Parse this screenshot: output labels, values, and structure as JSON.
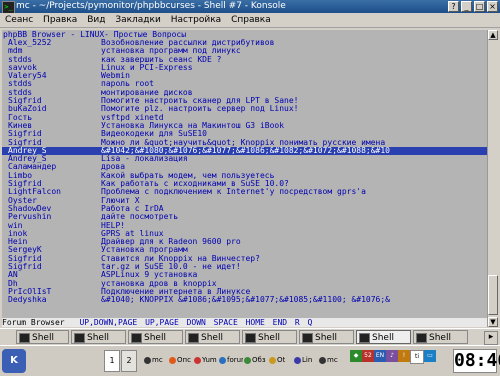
{
  "window": {
    "title": "mc - ~/Projects/pymonitor/phpbbcurses - Shell #7 - Konsole",
    "app_icon": "terminal-icon"
  },
  "menu": [
    "Сеанс",
    "Правка",
    "Вид",
    "Закладки",
    "Настройка",
    "Справка"
  ],
  "terminal": {
    "title_line": "phpBB Browser - LINUX- Простые Вопросы",
    "rows": [
      {
        "author": "Alex_5252",
        "subject": "Возобновление рассылки дистрибутивов"
      },
      {
        "author": "mdm",
        "subject": "установка программ под линукс"
      },
      {
        "author": "stdds",
        "subject": "как завершить сеанс KDE ?"
      },
      {
        "author": "savvok",
        "subject": "Linux и PCI-Express"
      },
      {
        "author": "Valery54",
        "subject": "Webmin"
      },
      {
        "author": "stdds",
        "subject": "пароль root"
      },
      {
        "author": "stdds",
        "subject": "монтирование дисков"
      },
      {
        "author": "Sigfrid",
        "subject": "Помогите настроить сканер для LPT в Sane!"
      },
      {
        "author": "buKaZoid",
        "subject": "Помогите plz. настроить сервер под Linux!"
      },
      {
        "author": "Гость",
        "subject": "vsftpd  xinetd"
      },
      {
        "author": "Кинев",
        "subject": "Установка Линукса на Макинтош G3 iBook"
      },
      {
        "author": "Sigfrid",
        "subject": "Видеокодеки для SuSE10"
      },
      {
        "author": "Sigfrid",
        "subject": "Можно ли &quot;научить&quot; Knoppix понимать русские имена"
      },
      {
        "author": "Andrey_S",
        "subject": "&#1042;&#1080;&#1076;&#1077;&#1086;&#1082;&#1072;&#1088;&#10",
        "selected": true
      },
      {
        "author": "Andrey_S",
        "subject": "Lisa - локализация"
      },
      {
        "author": "Саламандер",
        "subject": "дрова"
      },
      {
        "author": "Limbo",
        "subject": "Какой выбрать модем, чем пользуетесь"
      },
      {
        "author": "Sigfrid",
        "subject": "Как работать с исходниками в SuSE 10.0?"
      },
      {
        "author": "LightFalcon",
        "subject": "Проблема с подключением к Internet'у посредством gprs'а"
      },
      {
        "author": "Oyster",
        "subject": "Глючит X"
      },
      {
        "author": "ShadowDev",
        "subject": "Работа с IrDA"
      },
      {
        "author": "Pervushin",
        "subject": "дайте посмотреть"
      },
      {
        "author": "win",
        "subject": "HELP!"
      },
      {
        "author": "inok",
        "subject": "GPRS at linux"
      },
      {
        "author": "Hein",
        "subject": "Драйвер для к Radeon 9600 pro"
      },
      {
        "author": "SergeyK",
        "subject": "Установка программ"
      },
      {
        "author": "Sigfrid",
        "subject": "Ставится ли Knoppix на Винчестер?"
      },
      {
        "author": "Sigfrid",
        "subject": "tar.gz и SuSE 10.0 - не идет!"
      },
      {
        "author": "AN",
        "subject": "ASPLinux 9 установка"
      },
      {
        "author": "Dh",
        "subject": "установка дров в knoppix"
      },
      {
        "author": "PrIcOlIsT",
        "subject": "Подключение интернета в Линуксе"
      },
      {
        "author": "Dedyshka",
        "subject": "&#1040; KNOPPIX &#1086;&#1095;&#1077;&#1085;&#1100; &#1076;&"
      }
    ],
    "status": {
      "label": "Forum Browser",
      "keys": "UP,DOWN,PAGE UP,PAGE DOWN  SPACE  HOME  END  R  Q"
    }
  },
  "tabs": [
    "Shell",
    "Shell #2",
    "Shell #3",
    "Shell #4",
    "Shell #5",
    "Shell #6",
    "Shell #7",
    "Shell #8"
  ],
  "active_tab": "Shell #7",
  "taskbar": {
    "kmenu_icon": "kde-menu-icon",
    "pager": [
      "1",
      "2"
    ],
    "tasks": [
      "mc",
      "Oпс",
      "Yum",
      "forum",
      "Обз",
      "Ot",
      "Lin",
      "mc"
    ],
    "language": "EN",
    "clock": "08:46"
  }
}
